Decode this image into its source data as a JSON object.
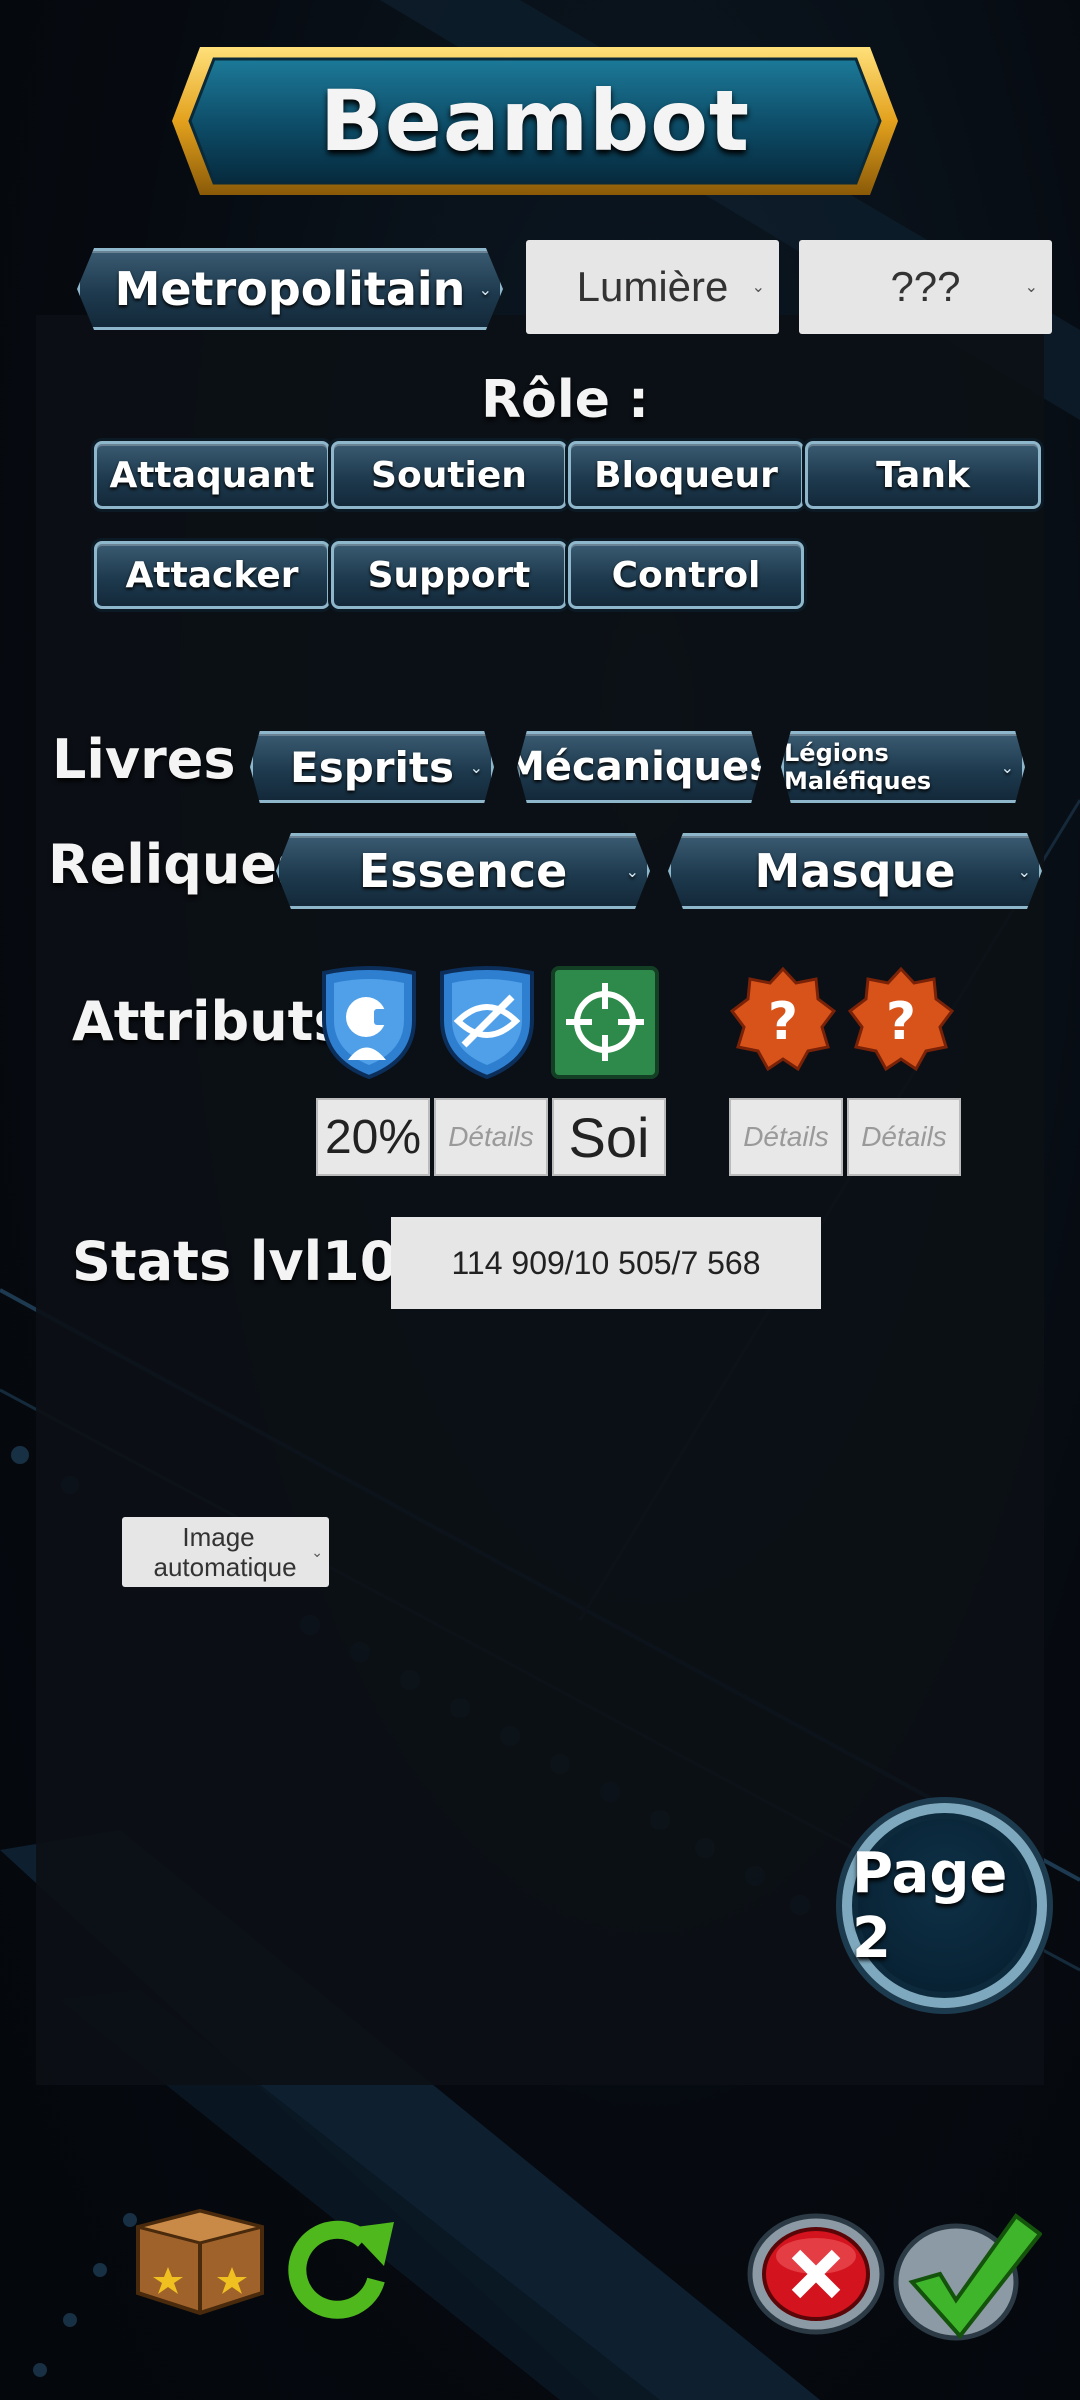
{
  "title": "Beambot",
  "faction_button": "Metropolitain",
  "element_select": "Lumière",
  "rarity_select": "???",
  "role": {
    "label": "Rôle :",
    "buttons_row1": [
      "Attaquant",
      "Soutien",
      "Bloqueur",
      "Tank"
    ],
    "buttons_row2": [
      "Attacker",
      "Support",
      "Control"
    ]
  },
  "books": {
    "label": "Livres :",
    "items": [
      "Esprits",
      "Mécaniques",
      "Légions Maléfiques"
    ]
  },
  "relics": {
    "label": "Reliques :",
    "items": [
      "Essence",
      "Masque"
    ]
  },
  "attributes": {
    "label": "Attributs :",
    "icons": [
      "knight-shield-icon",
      "invisible-shield-icon",
      "crosshair-icon",
      "unknown-badge-icon",
      "unknown-badge-icon"
    ],
    "values": [
      "20%",
      "Détails",
      "Soi",
      "Détails",
      "Détails"
    ]
  },
  "stats": {
    "label": "Stats lvl100 :",
    "value": "114 909/10 505/7 568"
  },
  "image_select": "Image automatique",
  "page_button": "Page 2",
  "colors": {
    "accent_gold": "#e3a11d",
    "button_teal": "#1e3a4e",
    "border_light": "#8fb7cc",
    "confirm_green": "#3fb52b",
    "cancel_red": "#d3131d"
  }
}
